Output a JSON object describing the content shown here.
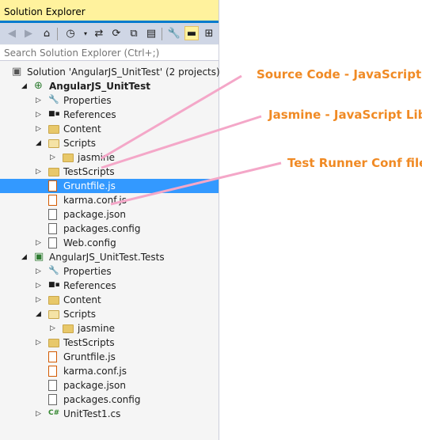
{
  "panel": {
    "title": "Solution Explorer",
    "search_placeholder": "Search Solution Explorer (Ctrl+;)"
  },
  "toolbar": {
    "icons": [
      "back-icon",
      "forward-icon",
      "home-icon",
      "history-icon",
      "pending-changes-icon",
      "sync-icon",
      "collapse-all-icon",
      "show-all-files-icon",
      "properties-icon",
      "preview-icon",
      "view-class-diagram-icon"
    ]
  },
  "tree": [
    {
      "label": "Solution 'AngularJS_UnitTest' (2 projects)",
      "level": 0,
      "expander": "",
      "icon": "solution-icon",
      "bold": false
    },
    {
      "label": "AngularJS_UnitTest",
      "level": 1,
      "expander": "open",
      "icon": "web-project-icon",
      "bold": true
    },
    {
      "label": "Properties",
      "level": 2,
      "expander": "closed",
      "icon": "wrench-icon",
      "bold": false
    },
    {
      "label": "References",
      "level": 2,
      "expander": "closed",
      "icon": "references-icon",
      "bold": false
    },
    {
      "label": "Content",
      "level": 2,
      "expander": "closed",
      "icon": "folder-icon",
      "bold": false
    },
    {
      "label": "Scripts",
      "level": 2,
      "expander": "open",
      "icon": "folder-open-icon",
      "bold": false
    },
    {
      "label": "jasmine",
      "level": 3,
      "expander": "closed",
      "icon": "folder-icon",
      "bold": false
    },
    {
      "label": "TestScripts",
      "level": 2,
      "expander": "closed",
      "icon": "folder-icon",
      "bold": false
    },
    {
      "label": "Gruntfile.js",
      "level": 2,
      "expander": "",
      "icon": "js-file-icon",
      "bold": false,
      "selected": true
    },
    {
      "label": "karma.conf.js",
      "level": 2,
      "expander": "",
      "icon": "js-file-icon",
      "bold": false
    },
    {
      "label": "package.json",
      "level": 2,
      "expander": "",
      "icon": "json-file-icon",
      "bold": false
    },
    {
      "label": "packages.config",
      "level": 2,
      "expander": "",
      "icon": "config-file-icon",
      "bold": false
    },
    {
      "label": "Web.config",
      "level": 2,
      "expander": "closed",
      "icon": "config-file-icon",
      "bold": false
    },
    {
      "label": "AngularJS_UnitTest.Tests",
      "level": 1,
      "expander": "open",
      "icon": "test-project-icon",
      "bold": false
    },
    {
      "label": "Properties",
      "level": 2,
      "expander": "closed",
      "icon": "wrench-icon",
      "bold": false
    },
    {
      "label": "References",
      "level": 2,
      "expander": "closed",
      "icon": "references-icon",
      "bold": false
    },
    {
      "label": "Content",
      "level": 2,
      "expander": "closed",
      "icon": "folder-icon",
      "bold": false
    },
    {
      "label": "Scripts",
      "level": 2,
      "expander": "open",
      "icon": "folder-open-icon",
      "bold": false
    },
    {
      "label": "jasmine",
      "level": 3,
      "expander": "closed",
      "icon": "folder-icon",
      "bold": false
    },
    {
      "label": "TestScripts",
      "level": 2,
      "expander": "closed",
      "icon": "folder-icon",
      "bold": false
    },
    {
      "label": "Gruntfile.js",
      "level": 2,
      "expander": "",
      "icon": "js-file-icon",
      "bold": false
    },
    {
      "label": "karma.conf.js",
      "level": 2,
      "expander": "",
      "icon": "js-file-icon",
      "bold": false
    },
    {
      "label": "package.json",
      "level": 2,
      "expander": "",
      "icon": "json-file-icon",
      "bold": false
    },
    {
      "label": "packages.config",
      "level": 2,
      "expander": "",
      "icon": "config-file-icon",
      "bold": false
    },
    {
      "label": "UnitTest1.cs",
      "level": 2,
      "expander": "closed",
      "icon": "csharp-file-icon",
      "bold": false
    }
  ],
  "annotations": [
    {
      "text": "Source Code - JavaScript"
    },
    {
      "text": "Jasmine - JavaScript Lib"
    },
    {
      "text": "Test Runner Conf file"
    }
  ],
  "colors": {
    "accent": "#007acc",
    "selection": "#3399ff",
    "annotation": "#f08a24",
    "pointer": "#f4a7c8",
    "title_bg": "#fff29d"
  }
}
